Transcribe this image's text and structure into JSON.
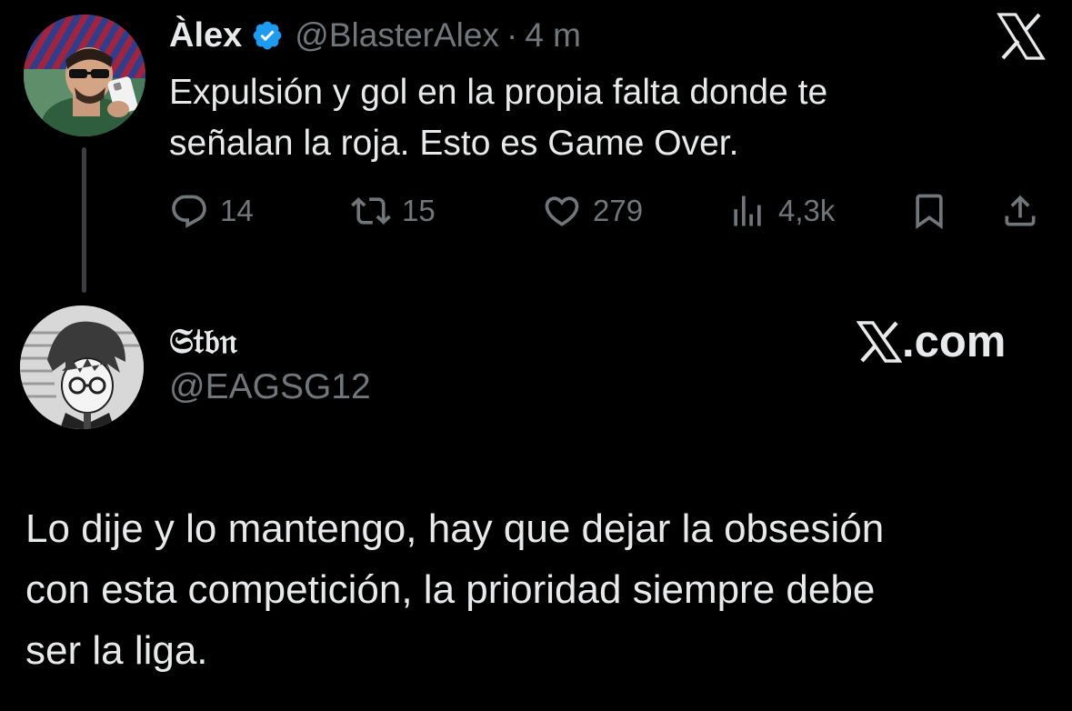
{
  "tweet": {
    "display_name": "Àlex",
    "handle": "@BlasterAlex",
    "separator": "·",
    "time": "4 m",
    "text_lines": [
      "Expulsión y gol en la propia falta donde te",
      "señalan la roja. Esto es Game Over."
    ],
    "actions": {
      "replies": "14",
      "retweets": "15",
      "likes": "279",
      "views": "4,3k"
    },
    "verified_color": "#1d9bf0",
    "icons": {
      "verified": "verified-badge-icon",
      "reply": "speech-bubble-icon",
      "retweet": "retweet-arrows-icon",
      "like": "heart-icon",
      "views": "bar-chart-icon",
      "bookmark": "bookmark-icon",
      "share": "share-upload-icon",
      "brand": "x-logo-icon"
    }
  },
  "quote": {
    "display_name": "𝔖𝔱𝔟𝔫",
    "handle": "@EAGSG12",
    "brand_text": ".com",
    "text_lines": [
      "Lo dije y lo mantengo, hay que dejar la obsesión",
      "con esta competición, la prioridad siempre debe",
      "ser la liga."
    ]
  },
  "colors": {
    "background": "#000000",
    "text_primary": "#e7e9ea",
    "text_secondary": "#71767b"
  }
}
